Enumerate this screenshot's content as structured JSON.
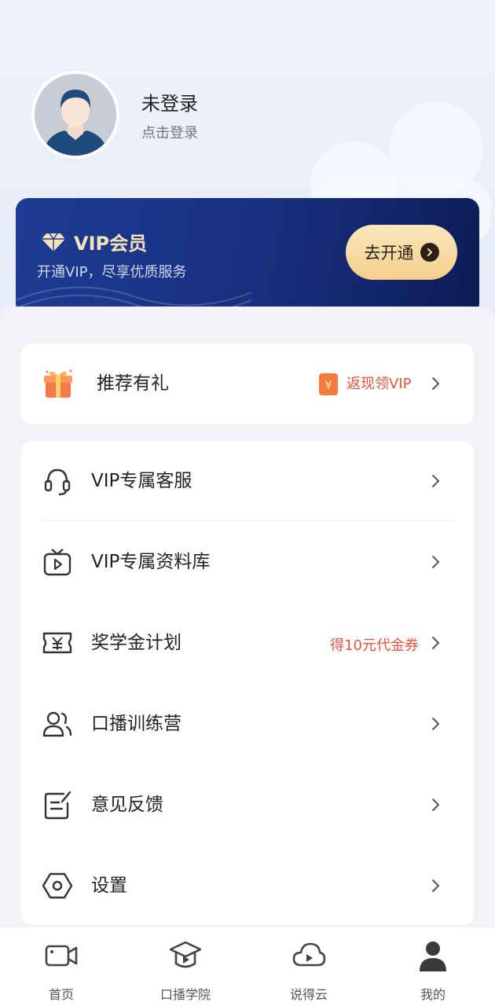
{
  "profile": {
    "name": "未登录",
    "subtitle": "点击登录"
  },
  "vip": {
    "title": "VIP会员",
    "subtitle": "开通VIP，尽享优质服务",
    "button_label": "去开通",
    "colors": {
      "card": "#1e3c94",
      "gold": "#f6e2b8",
      "button": "#f3cf8c"
    }
  },
  "referral": {
    "label": "推荐有礼",
    "tag": "返现领VIP",
    "icon": "gift-icon"
  },
  "menu": {
    "items": [
      {
        "label": "VIP专属客服",
        "icon": "headset-icon",
        "tag": ""
      },
      {
        "label": "VIP专属资料库",
        "icon": "video-library-icon",
        "tag": ""
      },
      {
        "label": "奖学金计划",
        "icon": "yuan-ticket-icon",
        "tag": "得10元代金券"
      },
      {
        "label": "口播训练营",
        "icon": "users-icon",
        "tag": ""
      },
      {
        "label": "意见反馈",
        "icon": "feedback-icon",
        "tag": ""
      },
      {
        "label": "设置",
        "icon": "settings-icon",
        "tag": ""
      }
    ]
  },
  "tabbar": {
    "tabs": [
      {
        "label": "首页",
        "icon": "video-camera-icon"
      },
      {
        "label": "口播学院",
        "icon": "academy-icon"
      },
      {
        "label": "说得云",
        "icon": "cloud-play-icon"
      },
      {
        "label": "我的",
        "icon": "person-icon"
      }
    ],
    "active_index": 3
  },
  "colors": {
    "accent_red": "#e0563f",
    "background": "#f2f3f7"
  }
}
